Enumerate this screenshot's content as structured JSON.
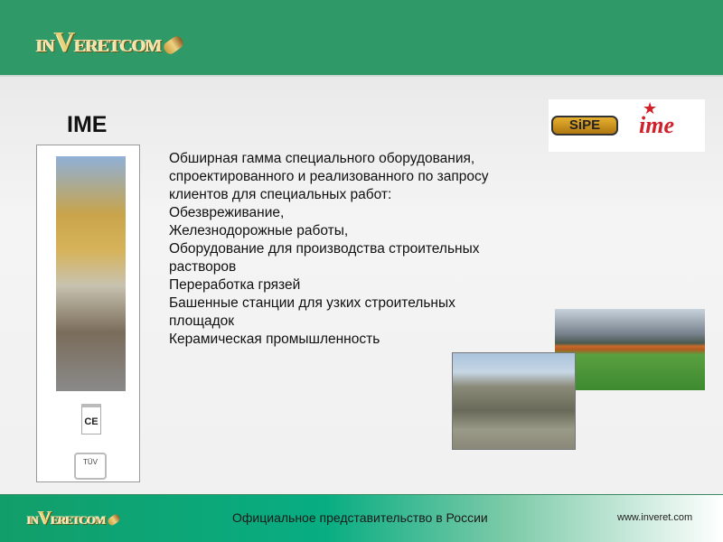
{
  "header": {
    "logo_text": "INVERETCOM"
  },
  "slide": {
    "title": "IME",
    "lines": [
      "Обширная гамма специального оборудования,",
      "спроектированного и реализованного по запросу",
      "клиентов для специальных работ:",
      "Обезвреживание,",
      "Железнодорожные работы,",
      "Оборудование для производства строительных",
      "растворов",
      "Переработка  грязей",
      "Башенные станции для узких строительных",
      "площадок",
      "Керамическая промышленность"
    ],
    "brands": {
      "sipe": "SiPE",
      "ime": "ime"
    },
    "certs": {
      "ce": "CE",
      "tuv": "TÜV"
    }
  },
  "footer": {
    "logo_text": "INVERETCOM",
    "text": "Официальное представительство в России",
    "url": "www.inveret.com"
  }
}
